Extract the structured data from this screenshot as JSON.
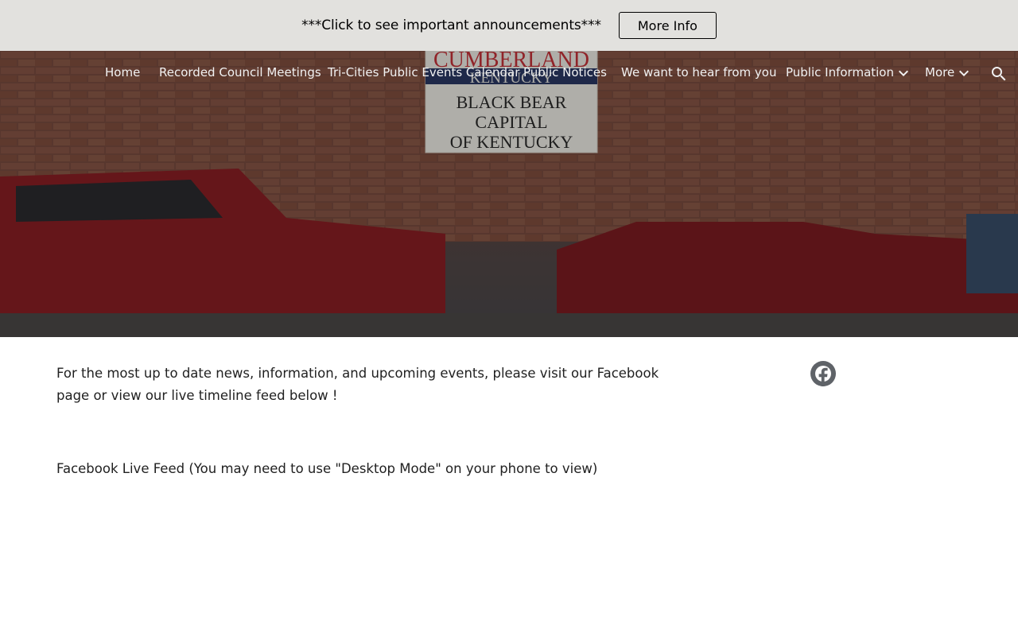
{
  "banner": {
    "text": "***Click to see important announcements***",
    "button_label": "More Info"
  },
  "nav": {
    "items": [
      {
        "label": "Home"
      },
      {
        "label": "Recorded Council Meetings"
      },
      {
        "label": "Tri-Cities Public Events Calendar"
      },
      {
        "label": "Public Notices"
      },
      {
        "label": "We want to hear from you"
      },
      {
        "label": "Public Information",
        "has_dropdown": true
      },
      {
        "label": "More",
        "has_dropdown": true
      }
    ],
    "search_icon": "search-icon"
  },
  "hero": {
    "sign_lines": [
      "CUMBERLAND",
      "KENTUCKY",
      "BLACK BEAR",
      "CAPITAL",
      "OF KENTUCKY"
    ],
    "sign_accent": "#c8323a"
  },
  "content": {
    "intro": "For the most up to date news, information, and upcoming events, please visit our Facebook page or view our live timeline feed below !",
    "feed_label": "Facebook Live Feed (You may need to use \"Desktop Mode\" on your phone to view)"
  },
  "social": {
    "facebook_icon": "facebook-icon",
    "icon_color": "#5f6368"
  }
}
